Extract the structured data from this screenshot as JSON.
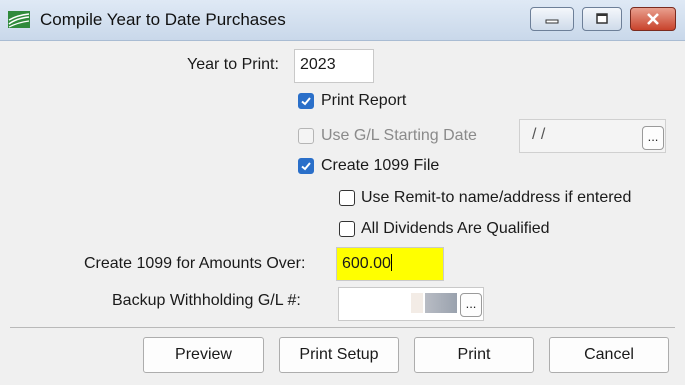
{
  "window": {
    "title": "Compile Year to Date Purchases",
    "controls": {
      "minimize_icon": "minimize-icon",
      "maximize_icon": "maximize-icon",
      "close_icon": "close-icon"
    }
  },
  "form": {
    "year_label": "Year to Print:",
    "year_value": "2023",
    "print_report": {
      "label": "Print Report",
      "checked": true
    },
    "use_gl_start": {
      "label": "Use G/L Starting Date",
      "checked": false,
      "enabled": false
    },
    "gl_start_date_value": "/ /",
    "create_1099": {
      "label": "Create 1099 File",
      "checked": true
    },
    "use_remit": {
      "label": "Use Remit-to name/address if entered",
      "checked": false
    },
    "all_dividends": {
      "label": "All Dividends Are Qualified",
      "checked": false
    },
    "amount_label": "Create 1099 for Amounts Over:",
    "amount_value": "600.00",
    "amount_highlight_color": "#ffff00",
    "backup_label": "Backup Withholding G/L #:",
    "backup_value": "",
    "ellipsis": "..."
  },
  "buttons": {
    "preview": "Preview",
    "print_setup": "Print Setup",
    "print": "Print",
    "cancel": "Cancel"
  },
  "colors": {
    "checkbox_accent": "#2a6fc9",
    "close_button": "#c8432c"
  }
}
